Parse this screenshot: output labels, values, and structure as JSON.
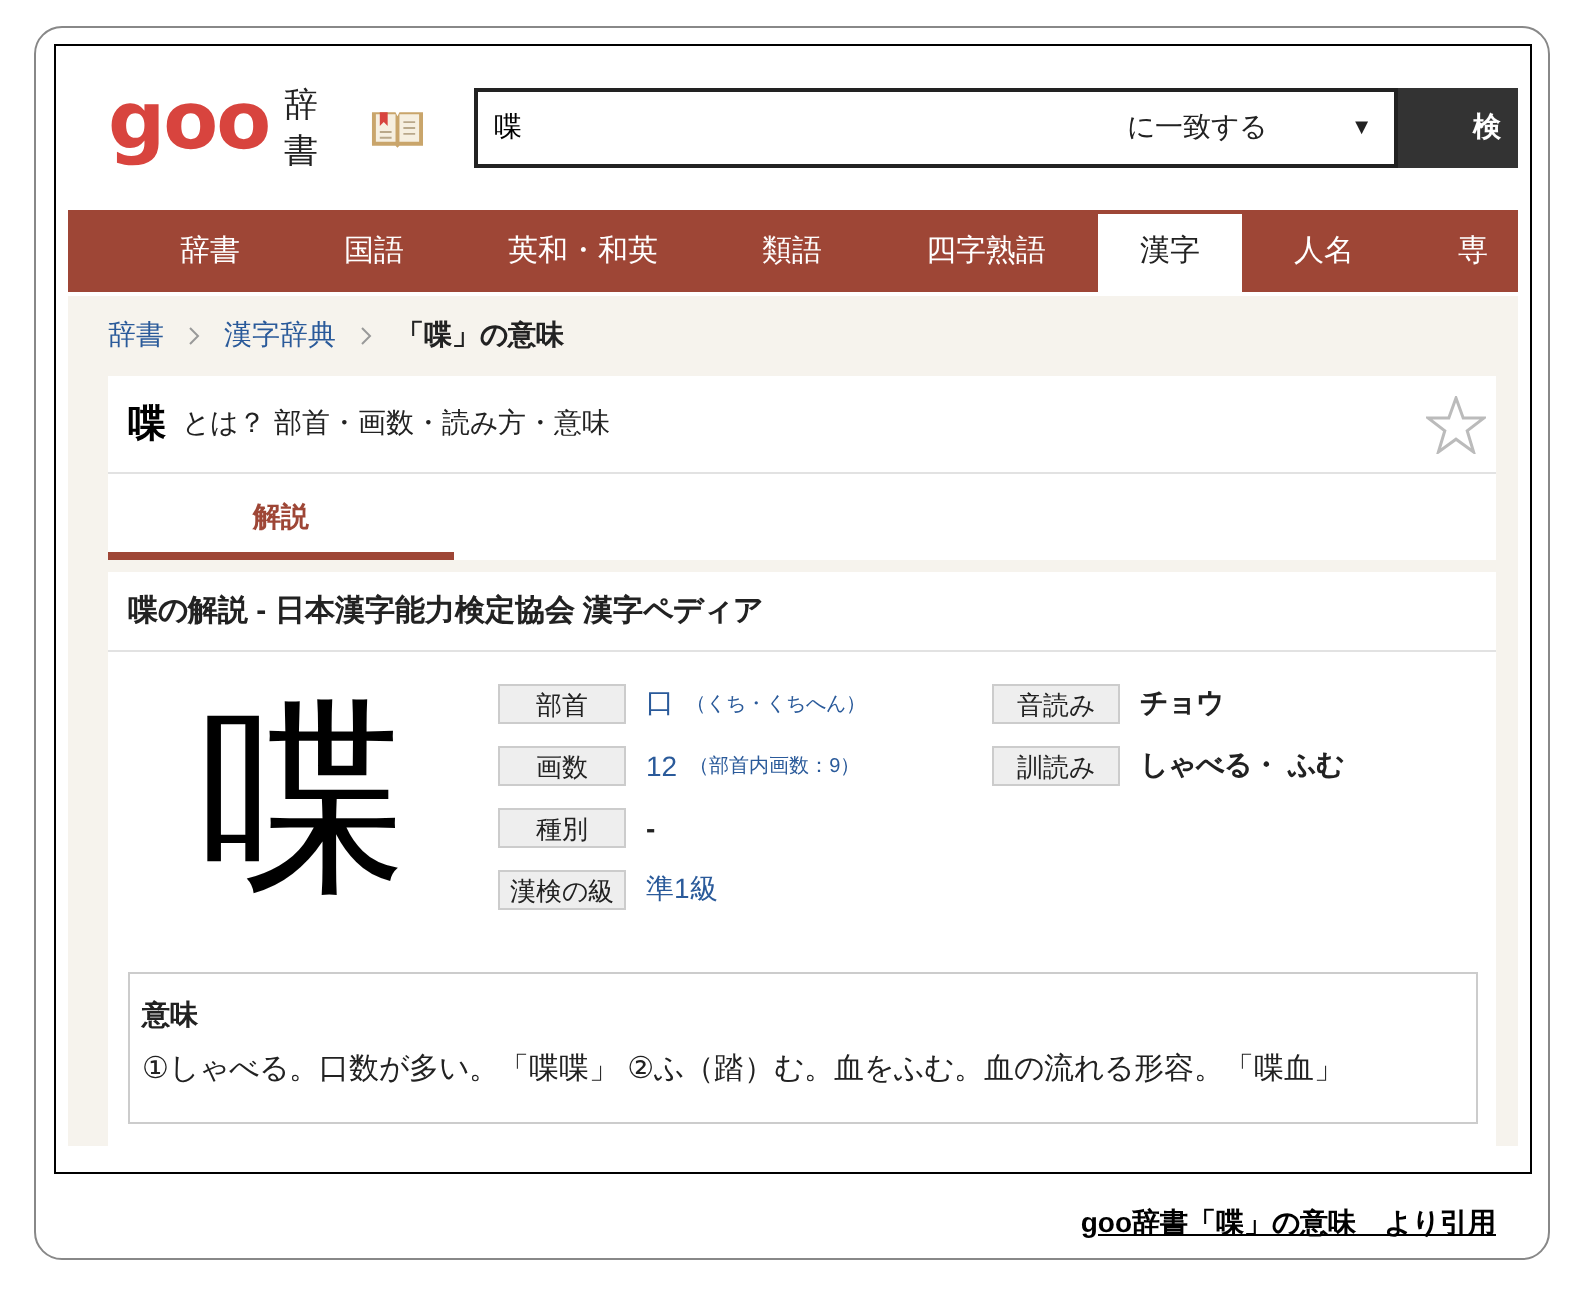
{
  "header": {
    "logo": "goo",
    "section": "辞書",
    "search": {
      "value": "喋",
      "match_mode": "に一致する",
      "caret": "▼",
      "button": "検"
    }
  },
  "nav": [
    {
      "label": "辞書",
      "selected": false
    },
    {
      "label": "国語",
      "selected": false
    },
    {
      "label": "英和・和英",
      "selected": false
    },
    {
      "label": "類語",
      "selected": false
    },
    {
      "label": "四字熟語",
      "selected": false
    },
    {
      "label": "漢字",
      "selected": true
    },
    {
      "label": "人名",
      "selected": false
    },
    {
      "label": "専",
      "selected": false
    }
  ],
  "breadcrumb": [
    {
      "label": "辞書",
      "kind": "link"
    },
    {
      "label": "漢字辞典",
      "kind": "link"
    },
    {
      "label": "「喋」の意味",
      "kind": "current"
    }
  ],
  "entry": {
    "kanji": "喋",
    "subtitle": "とは？ 部首・画数・読み方・意味",
    "favorite": false,
    "tabs": [
      {
        "label": "解説",
        "selected": true
      }
    ]
  },
  "commentary": {
    "heading": "喋の解説 - 日本漢字能力検定協会 漢字ペディア",
    "glyph": "喋",
    "left_fields": [
      {
        "label": "部首",
        "value": "口",
        "note": "（くち・くちへん）",
        "kind": "link"
      },
      {
        "label": "画数",
        "value": "12",
        "note": "（部首内画数：9）",
        "kind": "link"
      },
      {
        "label": "種別",
        "value": "-",
        "kind": "plain"
      },
      {
        "label": "漢検の級",
        "value": "準1級",
        "kind": "link"
      }
    ],
    "right_fields": [
      {
        "label": "音読み",
        "value": "チョウ",
        "kind": "plain"
      },
      {
        "label": "訓読み",
        "value": "しゃべる・ ふむ",
        "kind": "plain"
      }
    ],
    "meaning": {
      "title": "意味",
      "text": "①しゃべる。口数が多い。「喋喋」 ②ふ（踏）む。血をふむ。血の流れる形容。「喋血」"
    }
  },
  "caption": "goo辞書「喋」の意味　より引用"
}
